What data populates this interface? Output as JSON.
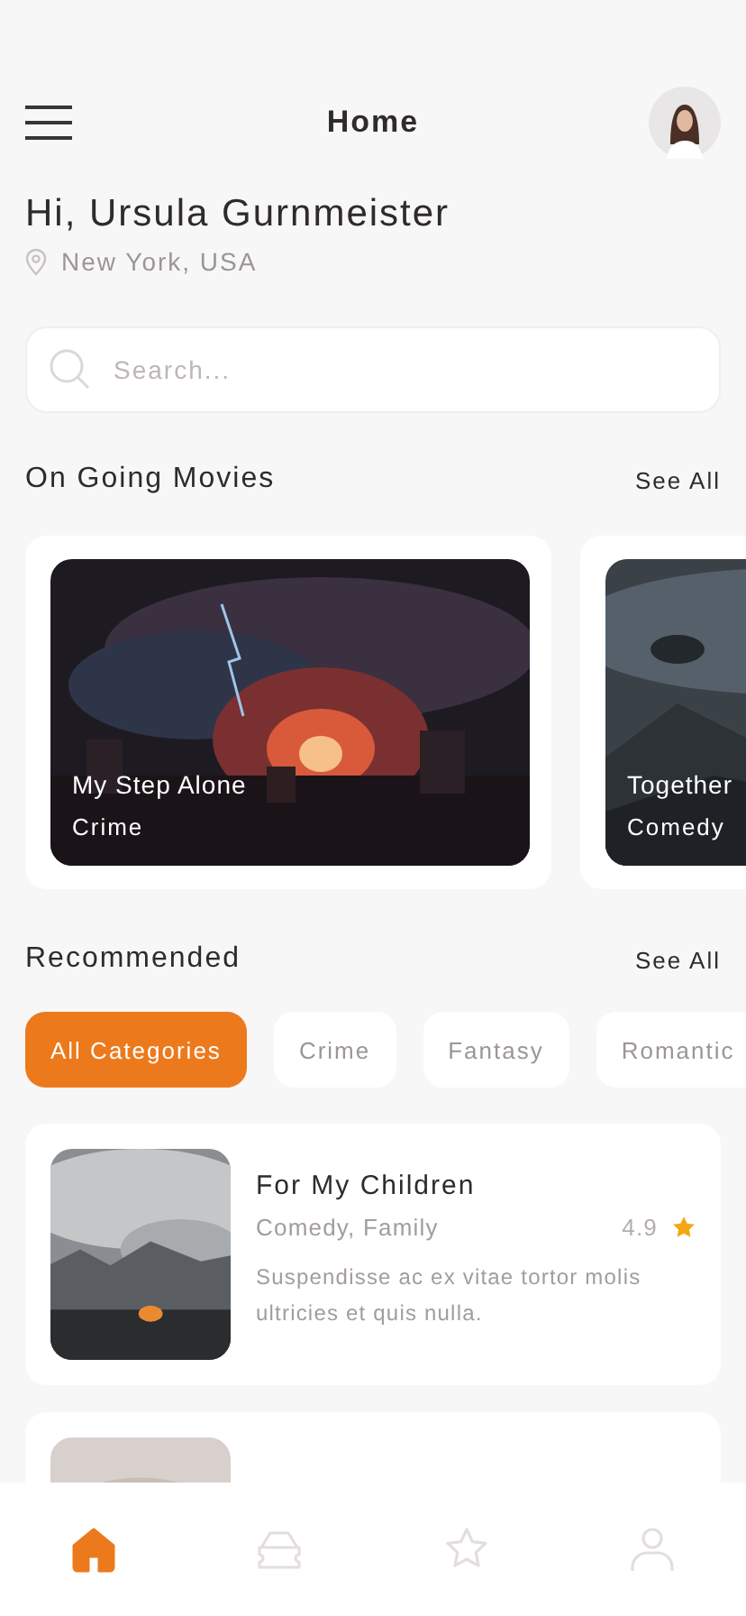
{
  "header": {
    "title": "Home"
  },
  "greeting": {
    "text": "Hi, Ursula Gurnmeister",
    "location": "New York, USA"
  },
  "search": {
    "placeholder": "Search..."
  },
  "ongoing": {
    "title": "On Going Movies",
    "action": "See All",
    "movies": [
      {
        "title": "My Step Alone",
        "genre": "Crime"
      },
      {
        "title": "Together",
        "genre": "Comedy"
      }
    ]
  },
  "recommended": {
    "title": "Recommended",
    "action": "See All",
    "categories": [
      {
        "label": "All Categories",
        "selected": true
      },
      {
        "label": "Crime",
        "selected": false
      },
      {
        "label": "Fantasy",
        "selected": false
      },
      {
        "label": "Romantic",
        "selected": false
      }
    ],
    "items": [
      {
        "kind": "movie",
        "title": "For My Children",
        "genres": "Comedy, Family",
        "rating": "4.9",
        "description": "Suspendisse ac ex vitae tortor molis ultricies et quis nulla."
      },
      {
        "kind": "picture"
      }
    ]
  },
  "nav": [
    {
      "selected": true
    },
    {
      "selected": false
    },
    {
      "selected": false
    },
    {
      "selected": false
    }
  ]
}
